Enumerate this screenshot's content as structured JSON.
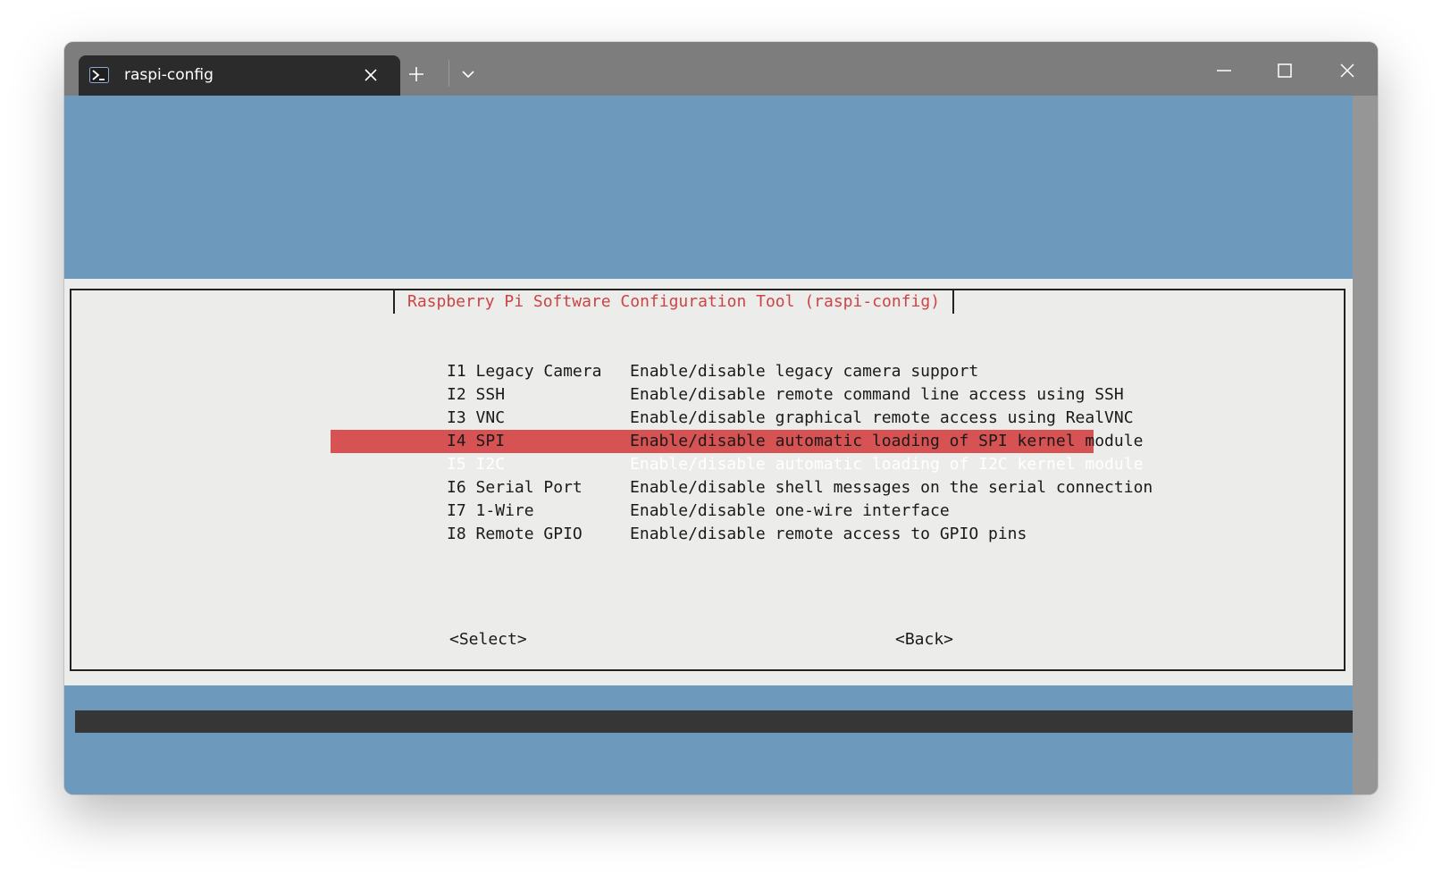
{
  "window": {
    "tab_title": "raspi-config"
  },
  "dialog": {
    "title": "Raspberry Pi Software Configuration Tool (raspi-config)",
    "items": [
      {
        "key": "I1 Legacy Camera",
        "desc": "Enable/disable legacy camera support"
      },
      {
        "key": "I2 SSH",
        "desc": "Enable/disable remote command line access using SSH"
      },
      {
        "key": "I3 VNC",
        "desc": "Enable/disable graphical remote access using RealVNC"
      },
      {
        "key": "I4 SPI",
        "desc": "Enable/disable automatic loading of SPI kernel module"
      },
      {
        "key": "I5 I2C",
        "desc": "Enable/disable automatic loading of I2C kernel module"
      },
      {
        "key": "I6 Serial Port",
        "desc": "Enable/disable shell messages on the serial connection"
      },
      {
        "key": "I7 1-Wire",
        "desc": "Enable/disable one-wire interface"
      },
      {
        "key": "I8 Remote GPIO",
        "desc": "Enable/disable remote access to GPIO pins"
      }
    ],
    "selected_index": 4,
    "select_label": "<Select>",
    "back_label": "<Back>"
  },
  "colors": {
    "terminal_bg": "#6d9abc",
    "dialog_bg": "#ececea",
    "accent_red": "#d65253",
    "title_red": "#cc4444"
  },
  "icons": {
    "tab": "powershell-icon",
    "tab_close": "close-icon",
    "new_tab": "plus-icon",
    "dropdown": "chevron-down-icon",
    "minimize": "minimize-icon",
    "maximize": "maximize-icon",
    "close": "close-icon"
  }
}
